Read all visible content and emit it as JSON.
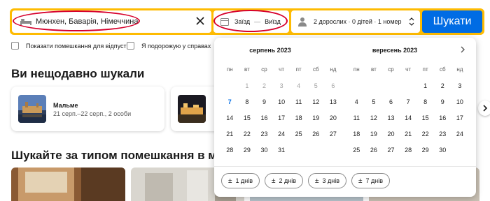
{
  "search": {
    "destination": "Мюнхен, Баварія, Німеччина",
    "checkin_label": "Заїзд",
    "dash": "—",
    "checkout_label": "Виїзд",
    "guests": "2 дорослих · 0 дітей · 1 номер",
    "submit_label": "Шукати"
  },
  "filters": {
    "vacation_rentals": "Показати помешкання для відпустки",
    "business_trip": "Я подорожую у справах"
  },
  "recent": {
    "heading": "Ви нещодавно шукали",
    "cards": [
      {
        "title": "Мальме",
        "subtitle": "21 серп.–22 серп., 2 особи"
      }
    ]
  },
  "property_types": {
    "heading": "Шукайте за типом помешкання в місті М"
  },
  "calendar": {
    "months": [
      {
        "title": "серпень 2023",
        "weekdays": [
          "пн",
          "вт",
          "ср",
          "чт",
          "пт",
          "сб",
          "нд"
        ],
        "leading_blanks": 1,
        "days": [
          "1",
          "2",
          "3",
          "4",
          "5",
          "6",
          "7",
          "8",
          "9",
          "10",
          "11",
          "12",
          "13",
          "14",
          "15",
          "16",
          "17",
          "18",
          "19",
          "20",
          "21",
          "22",
          "23",
          "24",
          "25",
          "26",
          "27",
          "28",
          "29",
          "30",
          "31"
        ],
        "past_until": 6,
        "today": 7
      },
      {
        "title": "вересень 2023",
        "weekdays": [
          "пн",
          "вт",
          "ср",
          "чт",
          "пт",
          "сб",
          "нд"
        ],
        "leading_blanks": 4,
        "days": [
          "1",
          "2",
          "3",
          "4",
          "5",
          "6",
          "7",
          "8",
          "9",
          "10",
          "11",
          "12",
          "13",
          "14",
          "15",
          "16",
          "17",
          "18",
          "19",
          "20",
          "21",
          "22",
          "23",
          "24",
          "25",
          "26",
          "27",
          "28",
          "29",
          "30"
        ],
        "past_until": 0,
        "today": 0
      }
    ],
    "flex_chips": [
      {
        "sign": "±",
        "label": "1 днів"
      },
      {
        "sign": "±",
        "label": "2 днів"
      },
      {
        "sign": "±",
        "label": "3 днів"
      },
      {
        "sign": "±",
        "label": "7 днів"
      }
    ]
  },
  "colors": {
    "brand_yellow": "#febb02",
    "brand_blue": "#006ce4",
    "annotation_red": "#d6002c"
  }
}
